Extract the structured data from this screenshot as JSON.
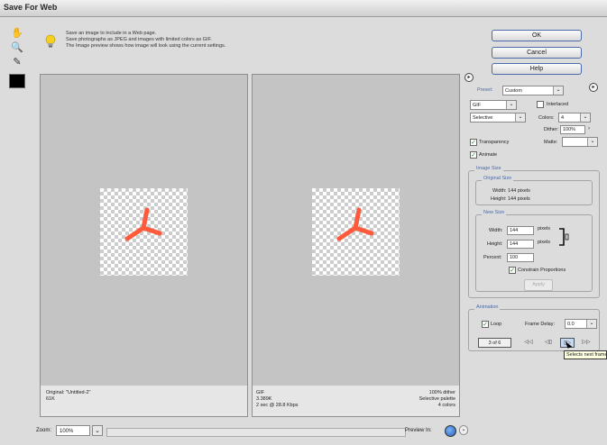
{
  "window": {
    "title": "Save For Web"
  },
  "toolbar": {
    "tools": [
      {
        "icon": "hand-icon"
      },
      {
        "icon": "zoom-icon"
      },
      {
        "icon": "eyedropper-icon"
      }
    ],
    "swatch_color": "#000000"
  },
  "hint": {
    "icon": "lightbulb-icon",
    "lines": [
      "Save an image to include in a Web page.",
      "Save photographs as JPEG and images with limited colors as GIF.",
      "The Image preview shows how image will look using the current settings."
    ]
  },
  "buttons": {
    "ok": "OK",
    "cancel": "Cancel",
    "help": "Help"
  },
  "original_info": {
    "line1": "Original: \"Untitled-2\"",
    "line2": "61K"
  },
  "optimized_info": {
    "left": [
      "GIF",
      "3.389K",
      "2 sec @ 28.8 Kbps"
    ],
    "right": [
      "100% dither",
      "Selective palette",
      "4 colors"
    ]
  },
  "zoom": {
    "label": "Zoom:",
    "value": "100%"
  },
  "preview": {
    "label": "Preview In:"
  },
  "settings": {
    "preset_label": "Preset:",
    "preset_value": "Custom",
    "format_value": "GIF",
    "interlaced_label": "Interlaced",
    "palette_value": "Selective",
    "colors_label": "Colors:",
    "colors_value": "4",
    "dither_label": "Dither:",
    "dither_value": "100%",
    "transparency_label": "Transparency",
    "matte_label": "Matte:",
    "animate_label": "Animate"
  },
  "image_size": {
    "title": "Image Size",
    "original_title": "Original Size",
    "width_line": "Width: 144 pixels",
    "height_line": "Height: 144 pixels",
    "new_title": "New Size",
    "width_label": "Width:",
    "width_value": "144",
    "height_label": "Height:",
    "height_value": "144",
    "pixels_label": "pixels",
    "percent_label": "Percent:",
    "percent_value": "100",
    "constrain_label": "Constrain Proportions",
    "apply_label": "Apply"
  },
  "animation": {
    "title": "Animation",
    "loop_label": "Loop",
    "frame_delay_label": "Frame Delay:",
    "frame_delay_value": "0.0",
    "frame_counter": "3 of 6",
    "tooltip": "Selects next frame"
  },
  "colors": {
    "accent": "#4a6aa8",
    "shape": "#ff5a3c"
  }
}
